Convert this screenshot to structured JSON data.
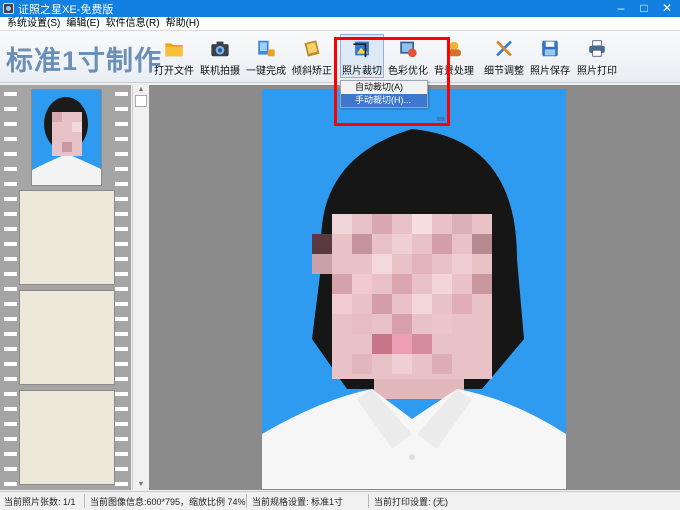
{
  "window": {
    "title": "证照之星XE-免费版",
    "controls": {
      "minimize": "–",
      "maximize": "□",
      "close": "✕"
    }
  },
  "menubar": {
    "items": [
      "系统设置(S)",
      "编辑(E)",
      "软件信息(R)",
      "帮助(H)"
    ]
  },
  "toolbar": {
    "brand": "标准1寸制作",
    "buttons": [
      {
        "label": "打开文件",
        "icon": "folder-icon"
      },
      {
        "label": "联机拍摄",
        "icon": "camera-icon"
      },
      {
        "label": "一键完成",
        "icon": "one-click-icon"
      },
      {
        "label": "倾斜矫正",
        "icon": "tilt-correct-icon"
      },
      {
        "label": "照片裁切",
        "icon": "crop-icon"
      },
      {
        "label": "色彩优化",
        "icon": "color-optimize-icon"
      },
      {
        "label": "背景处理",
        "icon": "background-icon"
      },
      {
        "label": "细节调整",
        "icon": "detail-adjust-icon"
      },
      {
        "label": "照片保存",
        "icon": "save-icon"
      },
      {
        "label": "照片打印",
        "icon": "printer-icon"
      }
    ]
  },
  "crop_menu": {
    "items": [
      "自动裁切(A)",
      "手动裁切(H)..."
    ],
    "highlighted_index": 1
  },
  "colors": {
    "titlebar": "#1180e0",
    "photo_background": "#2f9bf0",
    "highlight_box": "#ff0000",
    "menu_highlight": "#3d78cc"
  },
  "statusbar": {
    "photo_count": "当前照片张数: 1/1",
    "image_info": "当前图像信息:600*795，缩放比例 74%",
    "spec": "当前规格设置: 标准1寸",
    "print_setting": "当前打印设置: (无)"
  }
}
